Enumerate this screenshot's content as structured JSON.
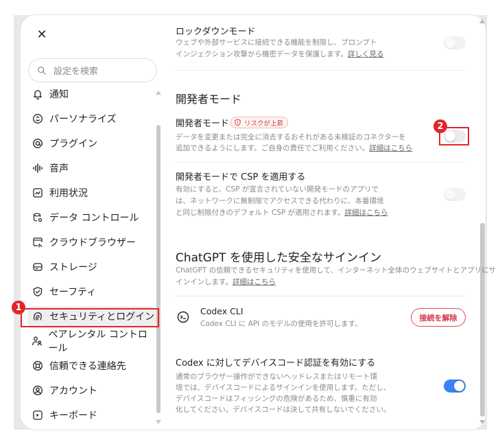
{
  "sidebar": {
    "close_symbol": "✕",
    "search_placeholder": "設定を検索",
    "items": [
      {
        "label": "通知",
        "icon": "bell-icon"
      },
      {
        "label": "パーソナライズ",
        "icon": "personalize-icon"
      },
      {
        "label": "プラグイン",
        "icon": "at-icon"
      },
      {
        "label": "音声",
        "icon": "voice-icon"
      },
      {
        "label": "利用状況",
        "icon": "usage-chart-icon"
      },
      {
        "label": "データ コントロール",
        "icon": "data-control-icon"
      },
      {
        "label": "クラウドブラウザー",
        "icon": "cloud-browser-icon"
      },
      {
        "label": "ストレージ",
        "icon": "storage-icon"
      },
      {
        "label": "セーフティ",
        "icon": "shield-check-icon"
      },
      {
        "label": "セキュリティとログイン",
        "icon": "security-login-icon"
      },
      {
        "label": "ペアレンタル コントロール",
        "icon": "parental-icon"
      },
      {
        "label": "信頼できる連絡先",
        "icon": "trusted-contact-icon"
      },
      {
        "label": "アカウント",
        "icon": "account-icon"
      },
      {
        "label": "キーボード",
        "icon": "keyboard-icon"
      }
    ],
    "active_index": 9
  },
  "annotations": {
    "badge1": "1",
    "badge2": "2",
    "color": "#e0262a"
  },
  "main": {
    "lockdown": {
      "title": "ロックダウンモード",
      "desc_line1": "ウェブや外部サービスに接続できる機能を制限し、プロンプト",
      "desc_line2": "インジェクション攻撃から機密データを保護します。",
      "link": "詳しく見る",
      "toggle_on": false
    },
    "dev_section_title": "開発者モード",
    "dev_mode": {
      "title": "開発者モード",
      "risk_badge": "リスクが上昇",
      "desc_line1": "データを変更または完全に消去するおそれがある未検証のコネクターを",
      "desc_line2": "追加できるようにします。ご自身の責任でご利用ください。",
      "link": "詳細はこちら",
      "toggle_on": false
    },
    "dev_csp": {
      "title": "開発者モードで CSP を適用する",
      "desc_line1": "有効にすると、CSP が宣言されていない開発モードのアプリで",
      "desc_line2": "は、ネットワークに無制限でアクセスできる代わりに、本番環境",
      "desc_line3": "と同じ制限付きのデフォルト CSP が適用されます。",
      "link": "詳細はこちら",
      "toggle_on": false
    },
    "secure_signin": {
      "title": "ChatGPT を使用した安全なサインイン",
      "desc_line1": "ChatGPT の信頼できるセキュリティを使用して、インターネット全体のウェブサイトとアプリにサ",
      "desc_line2": "インインします。",
      "link": "詳細はこちら"
    },
    "codex_cli": {
      "title": "Codex CLI",
      "desc": "Codex CLI に API のモデルの使用を許可します。",
      "button": "接続を解除",
      "icon": "codex-terminal-icon"
    },
    "device_code": {
      "title": "Codex に対してデバイスコード認証を有効にする",
      "desc_line1": "通常のブラウザー操作ができないヘッドレスまたはリモート環",
      "desc_line2": "境では、デバイスコードによるサインインを使用します。ただし、",
      "desc_line3": "デバイスコードはフィッシングの危険があるため、慎重に有効",
      "desc_line4": "化してください。デバイスコードは決して共有しないでください。",
      "toggle_on": true
    }
  },
  "colors": {
    "accent": "#3b82f6",
    "danger": "#e0262a",
    "button_danger": "#d6354a"
  }
}
